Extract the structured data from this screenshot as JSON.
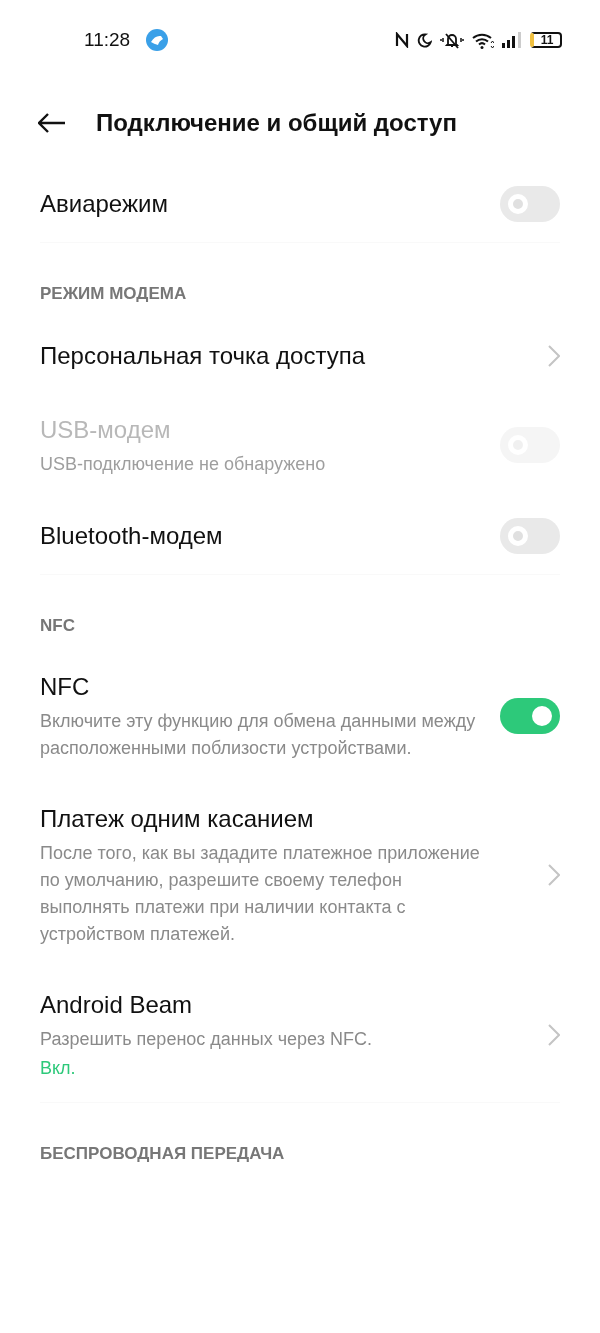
{
  "status_bar": {
    "time": "11:28",
    "battery": "11"
  },
  "header": {
    "title": "Подключение и общий доступ"
  },
  "sections": [
    {
      "items": [
        {
          "kind": "toggle",
          "title": "Авиарежим",
          "on": false,
          "disabled": false
        }
      ]
    },
    {
      "heading": "РЕЖИМ МОДЕМА",
      "items": [
        {
          "kind": "link",
          "title": "Персональная точка доступа",
          "disabled": false
        },
        {
          "kind": "toggle",
          "title": "USB-модем",
          "subtitle": "USB-подключение не обнаружено",
          "on": false,
          "disabled": true
        },
        {
          "kind": "toggle",
          "title": "Bluetooth-модем",
          "on": false,
          "disabled": false
        }
      ]
    },
    {
      "heading": "NFC",
      "items": [
        {
          "kind": "toggle",
          "title": "NFC",
          "subtitle": "Включите эту функцию для обмена данными между расположенными поблизости устройствами.",
          "on": true,
          "disabled": false
        },
        {
          "kind": "link",
          "title": "Платеж одним касанием",
          "subtitle": "После того, как вы зададите платежное приложение по умолчанию, разрешите своему телефон выполнять платежи при наличии контакта с устройством платежей.",
          "disabled": false
        },
        {
          "kind": "link",
          "title": "Android Beam",
          "subtitle": "Разрешить перенос данных через NFC.",
          "status": "Вкл.",
          "disabled": false
        }
      ]
    },
    {
      "heading": "БЕСПРОВОДНАЯ ПЕРЕДАЧА"
    }
  ]
}
